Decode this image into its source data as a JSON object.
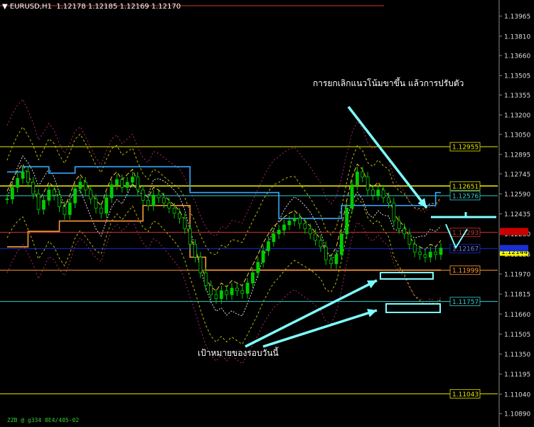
{
  "header": {
    "symbol": "EURUSD,H1",
    "ohlc": "1.12178 1.12185 1.12169 1.12170"
  },
  "annotations": {
    "top": "การยกเลิกแนวโน้มขาขึ้น แล้วการปรับตัว",
    "bottom": "เป้าหมายของรอบวันนี้"
  },
  "footer": "ZZB @ g334 8E4/405-02",
  "colors": {
    "background": "#000000",
    "bull_candle": "#00cc00",
    "price_label_current": "#ffff00",
    "price_label_blue": "#1a2fd0",
    "price_label_red": "#cc0000",
    "arrow": "#7fffff",
    "level_yellow": "#e6e600",
    "level_cyan": "#33cccc",
    "level_orange": "#ff9933",
    "level_red": "#cc3333",
    "channel_blue": "#33aaff"
  },
  "chart_data": {
    "type": "line",
    "ylim": [
      1.1083,
      1.14035
    ],
    "y_ticks": [
      "1.13965",
      "1.13810",
      "1.13660",
      "1.13505",
      "1.13355",
      "1.13200",
      "1.13050",
      "1.12895",
      "1.12745",
      "1.12590",
      "1.12435",
      "1.12280",
      "1.12125",
      "1.11970",
      "1.11815",
      "1.11660",
      "1.11505",
      "1.11350",
      "1.11195",
      "1.11040",
      "1.10890"
    ],
    "levels": [
      {
        "label": "1.12955",
        "value": 1.12955,
        "color": "#e6e600"
      },
      {
        "label": "1.12651",
        "value": 1.12651,
        "color": "#e6e600"
      },
      {
        "label": "1.12576",
        "value": 1.12576,
        "color": "#33cccc"
      },
      {
        "label": "1.12293",
        "value": 1.12293,
        "color": "#cc3333"
      },
      {
        "label": "1.12167",
        "value": 1.12167,
        "color": "#1a2fd0"
      },
      {
        "label": "1.11999",
        "value": 1.11999,
        "color": "#ff9933"
      },
      {
        "label": "1.11757",
        "value": 1.11757,
        "color": "#33cccc"
      },
      {
        "label": "1.11043",
        "value": 1.11043,
        "color": "#e6e600"
      }
    ],
    "current_price": {
      "label": "1.12144",
      "value": 1.12144
    },
    "close_series": [
      1.1255,
      1.1264,
      1.1271,
      1.1276,
      1.1268,
      1.1259,
      1.1247,
      1.1254,
      1.1262,
      1.1258,
      1.1249,
      1.1243,
      1.1252,
      1.1263,
      1.1268,
      1.1262,
      1.1255,
      1.1248,
      1.1244,
      1.1256,
      1.1266,
      1.127,
      1.1264,
      1.1268,
      1.1272,
      1.1262,
      1.1254,
      1.125,
      1.1258,
      1.1256,
      1.1252,
      1.1248,
      1.1244,
      1.124,
      1.1232,
      1.122,
      1.121,
      1.1198,
      1.1188,
      1.1181,
      1.1178,
      1.1184,
      1.1181,
      1.1186,
      1.1184,
      1.1182,
      1.119,
      1.1198,
      1.1206,
      1.1215,
      1.1222,
      1.1228,
      1.1231,
      1.1235,
      1.1238,
      1.124,
      1.1236,
      1.1232,
      1.1228,
      1.1223,
      1.1218,
      1.1208,
      1.1205,
      1.1212,
      1.1228,
      1.1248,
      1.1266,
      1.1276,
      1.1272,
      1.1262,
      1.1258,
      1.1262,
      1.1256,
      1.1252,
      1.1238,
      1.1232,
      1.1228,
      1.122,
      1.1214,
      1.1212,
      1.121,
      1.1214,
      1.1212,
      1.1217
    ],
    "upper_channel": [
      1.1276,
      1.1276,
      1.1276,
      1.128,
      1.128,
      1.128,
      1.128,
      1.128,
      1.1275,
      1.1275,
      1.1275,
      1.1275,
      1.1275,
      1.128,
      1.128,
      1.128,
      1.128,
      1.128,
      1.128,
      1.128,
      1.128,
      1.128,
      1.128,
      1.128,
      1.128,
      1.128,
      1.128,
      1.128,
      1.128,
      1.128,
      1.128,
      1.128,
      1.128,
      1.128,
      1.128,
      1.126,
      1.126,
      1.126,
      1.126,
      1.126,
      1.126,
      1.126,
      1.126,
      1.126,
      1.126,
      1.126,
      1.126,
      1.126,
      1.126,
      1.126,
      1.126,
      1.126,
      1.124,
      1.124,
      1.124,
      1.124,
      1.124,
      1.124,
      1.124,
      1.124,
      1.124,
      1.124,
      1.124,
      1.124,
      1.125,
      1.125,
      1.125,
      1.125,
      1.125,
      1.125,
      1.125,
      1.125,
      1.125,
      1.125,
      1.125,
      1.125,
      1.125,
      1.125,
      1.125,
      1.125,
      1.125,
      1.125,
      1.126,
      1.126
    ],
    "lower_channel": [
      1.1218,
      1.1218,
      1.1218,
      1.1218,
      1.123,
      1.123,
      1.123,
      1.123,
      1.123,
      1.123,
      1.1238,
      1.1238,
      1.1238,
      1.1238,
      1.1238,
      1.1238,
      1.1238,
      1.1238,
      1.1238,
      1.1238,
      1.1238,
      1.1238,
      1.1238,
      1.1238,
      1.1238,
      1.1238,
      1.125,
      1.125,
      1.125,
      1.125,
      1.125,
      1.125,
      1.125,
      1.125,
      1.125,
      1.121,
      1.121,
      1.121,
      1.12,
      1.12,
      1.12,
      1.12,
      1.12,
      1.12,
      1.12,
      1.12,
      1.12,
      1.12,
      1.12,
      1.12,
      1.12,
      1.12,
      1.12,
      1.12,
      1.12,
      1.12,
      1.12,
      1.12,
      1.12,
      1.12,
      1.12,
      1.12,
      1.12,
      1.12,
      1.12,
      1.12,
      1.12,
      1.12,
      1.12,
      1.12,
      1.12,
      1.12,
      1.12,
      1.12,
      1.12,
      1.12,
      1.12,
      1.12,
      1.12,
      1.12,
      1.12,
      1.12,
      1.12,
      1.12
    ]
  }
}
